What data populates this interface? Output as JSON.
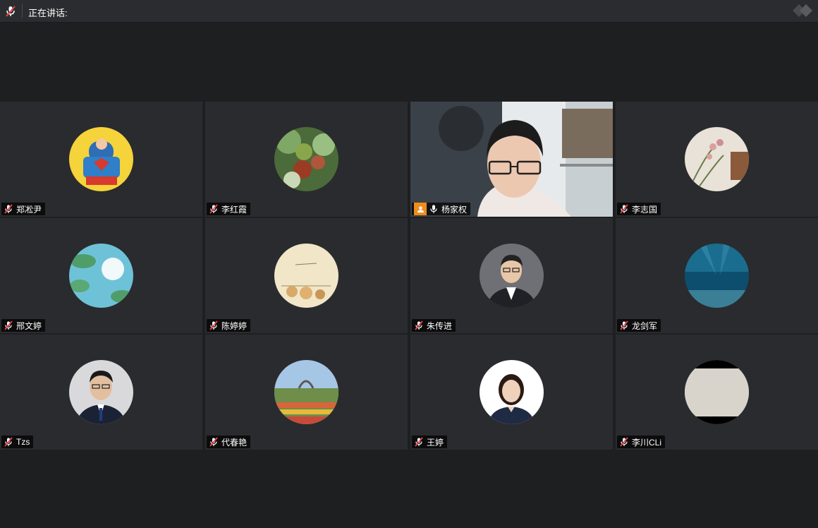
{
  "header": {
    "speaking_label": "正在讲话:",
    "mic_icon": "mic-muted-icon",
    "logo_icon": "app-logo-icon"
  },
  "participants": [
    {
      "name": "郑凇尹",
      "avatar": "superman-avatar",
      "muted": true
    },
    {
      "name": "李红霞",
      "avatar": "fruit-avatar",
      "muted": true
    },
    {
      "name": "杨家权",
      "avatar": "live-video",
      "muted": false,
      "video": true
    },
    {
      "name": "李志国",
      "avatar": "orchid-avatar",
      "muted": true
    },
    {
      "name": "邢文婷",
      "avatar": "sky-leaves-avatar",
      "muted": true
    },
    {
      "name": "陈婷婷",
      "avatar": "cartoon-cats-avatar",
      "muted": true
    },
    {
      "name": "朱传进",
      "avatar": "man-portrait-avatar",
      "muted": true
    },
    {
      "name": "龙剑军",
      "avatar": "underwater-avatar",
      "muted": true
    },
    {
      "name": "Tzs",
      "avatar": "man-suit-avatar",
      "muted": true
    },
    {
      "name": "代春艳",
      "avatar": "garden-avatar",
      "muted": true
    },
    {
      "name": "王婷",
      "avatar": "woman-portrait-avatar",
      "muted": true
    },
    {
      "name": "李川CLi",
      "avatar": "blurred-avatar",
      "muted": true
    }
  ],
  "colors": {
    "background": "#1e1f21",
    "tile": "#2a2b2e",
    "accent": "#f08c1a",
    "muted_icon": "#e8454a"
  }
}
